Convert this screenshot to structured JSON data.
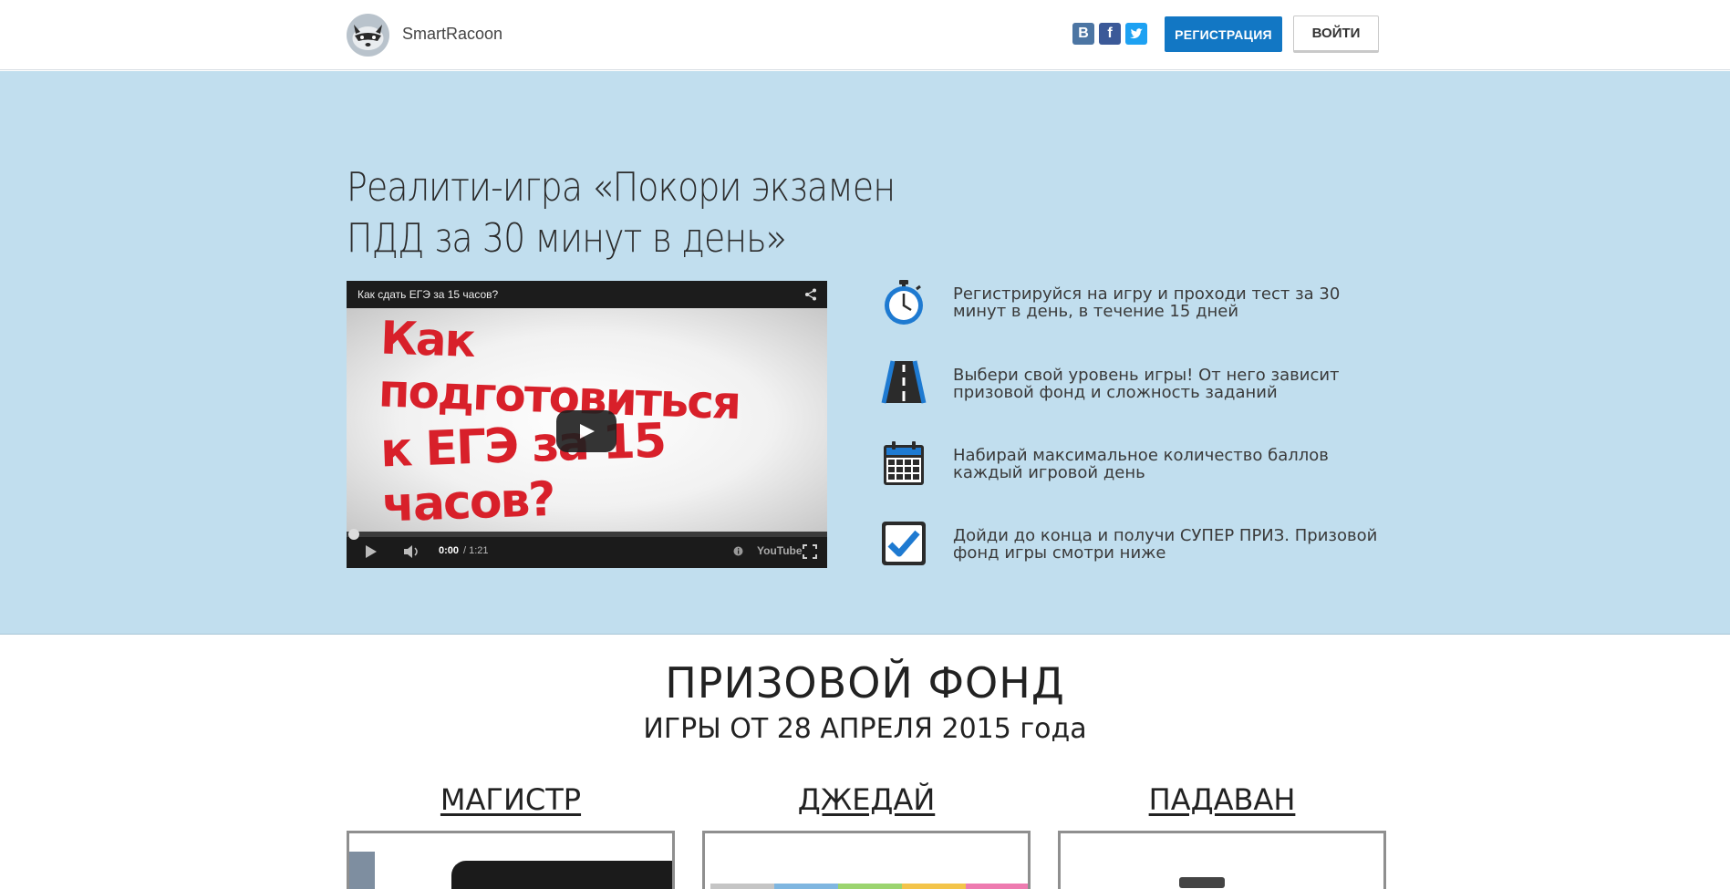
{
  "header": {
    "logo_text": "SmartRacoon",
    "social": [
      {
        "name": "vkontakte",
        "glyph": "В",
        "color": "#4c75a3"
      },
      {
        "name": "facebook",
        "glyph": "f",
        "color": "#3b5998"
      },
      {
        "name": "twitter",
        "glyph": "t",
        "color": "#1da1f2"
      }
    ],
    "register_label": "РЕГИСТРАЦИЯ",
    "login_label": "ВОЙТИ"
  },
  "hero": {
    "title_line1": "Реалити-игра «Покори экзамен",
    "title_line2": "ПДД за 30 минут в день»",
    "video": {
      "title": "Как сдать ЕГЭ за 15 часов?",
      "frame_line1": "Как подготовиться",
      "frame_line2": "к ЕГЭ за 15 часов?",
      "time_current": "0:00",
      "time_total": "/ 1:21",
      "brand": "YouTube"
    },
    "features": [
      {
        "icon": "stopwatch-icon",
        "text": "Регистрируйся на игру и проходи тест за 30 минут в день, в течение 15 дней"
      },
      {
        "icon": "road-icon",
        "text": "Выбери свой уровень игры! От него зависит призовой фонд и сложность заданий"
      },
      {
        "icon": "calendar-icon",
        "text": "Набирай максимальное количество баллов каждый игровой день"
      },
      {
        "icon": "checkbox-icon",
        "text": "Дойди до конца и получи СУПЕР ПРИЗ. Призовой фонд игры смотри ниже"
      }
    ]
  },
  "prize": {
    "title": "ПРИЗОВОЙ ФОНД",
    "subtitle": "ИГРЫ ОТ 28 АПРЕЛЯ 2015 года",
    "levels": [
      "МАГИСТР",
      "ДЖЕДАЙ",
      "ПАДАВАН"
    ]
  },
  "colors": {
    "hero_bg": "#c1deee",
    "primary": "#1277c4",
    "icon_blue": "#1e7ad1"
  }
}
